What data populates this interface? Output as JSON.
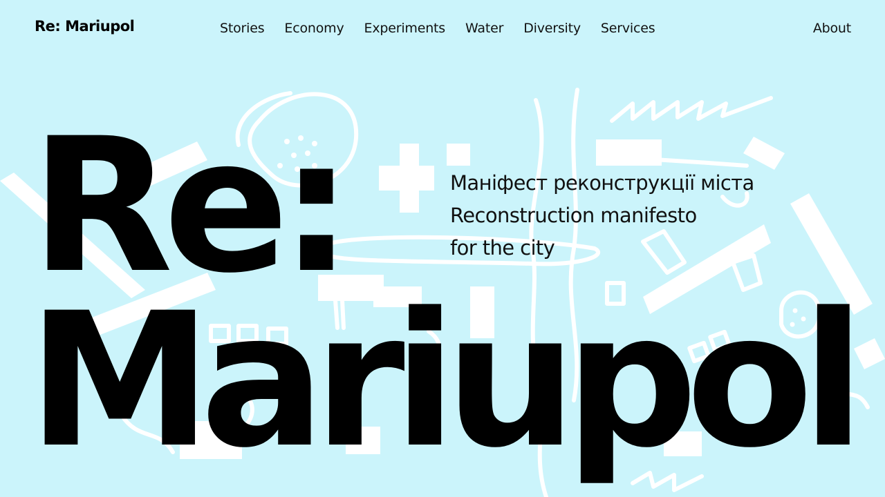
{
  "header": {
    "logo": "Re: Mariupol",
    "nav": [
      {
        "label": "Stories"
      },
      {
        "label": "Economy"
      },
      {
        "label": "Experiments"
      },
      {
        "label": "Water"
      },
      {
        "label": "Diversity"
      },
      {
        "label": "Services"
      }
    ],
    "about": "About"
  },
  "hero": {
    "title_line1": "Re:",
    "title_line2": "Mariupol",
    "subtitle": [
      "Маніфест реконструкції міста",
      "Reconstruction manifesto",
      "for the city"
    ]
  },
  "colors": {
    "background": "#cbf4fb",
    "doodle": "#ffffff",
    "text": "#000000"
  }
}
